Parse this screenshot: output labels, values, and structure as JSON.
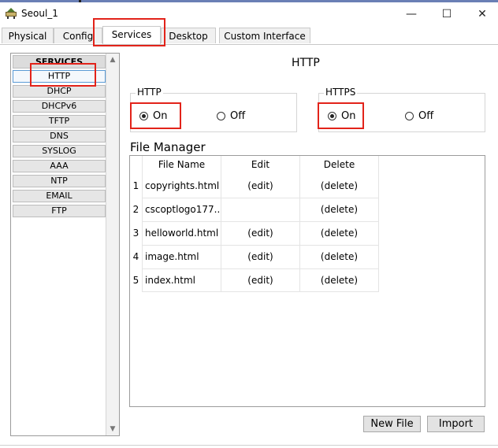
{
  "window": {
    "title": "Seoul_1",
    "minimize_glyph": "—",
    "maximize_glyph": "☐",
    "close_glyph": "✕"
  },
  "tabs": [
    {
      "label": "Physical"
    },
    {
      "label": "Config"
    },
    {
      "label": "Services"
    },
    {
      "label": "Desktop"
    },
    {
      "label": "Custom Interface"
    }
  ],
  "sidebar": {
    "header": "SERVICES",
    "items": [
      {
        "label": "HTTP"
      },
      {
        "label": "DHCP"
      },
      {
        "label": "DHCPv6"
      },
      {
        "label": "TFTP"
      },
      {
        "label": "DNS"
      },
      {
        "label": "SYSLOG"
      },
      {
        "label": "AAA"
      },
      {
        "label": "NTP"
      },
      {
        "label": "EMAIL"
      },
      {
        "label": "FTP"
      }
    ]
  },
  "main": {
    "title": "HTTP",
    "http": {
      "legend": "HTTP",
      "on_label": "On",
      "off_label": "Off",
      "selected": "On"
    },
    "https": {
      "legend": "HTTPS",
      "on_label": "On",
      "off_label": "Off",
      "selected": "On"
    },
    "file_manager": {
      "title": "File Manager",
      "columns": [
        "File Name",
        "Edit",
        "Delete"
      ],
      "rows": [
        {
          "num": "1",
          "name": "copyrights.html",
          "edit": "(edit)",
          "delete": "(delete)"
        },
        {
          "num": "2",
          "name": "cscoptlogo177...",
          "edit": "",
          "delete": "(delete)"
        },
        {
          "num": "3",
          "name": "helloworld.html",
          "edit": "(edit)",
          "delete": "(delete)"
        },
        {
          "num": "4",
          "name": "image.html",
          "edit": "(edit)",
          "delete": "(delete)"
        },
        {
          "num": "5",
          "name": "index.html",
          "edit": "(edit)",
          "delete": "(delete)"
        }
      ]
    },
    "buttons": {
      "new_file": "New File",
      "import": "Import"
    }
  },
  "colors": {
    "highlight": "#e2231a",
    "selected_border": "#5b9bd5"
  }
}
